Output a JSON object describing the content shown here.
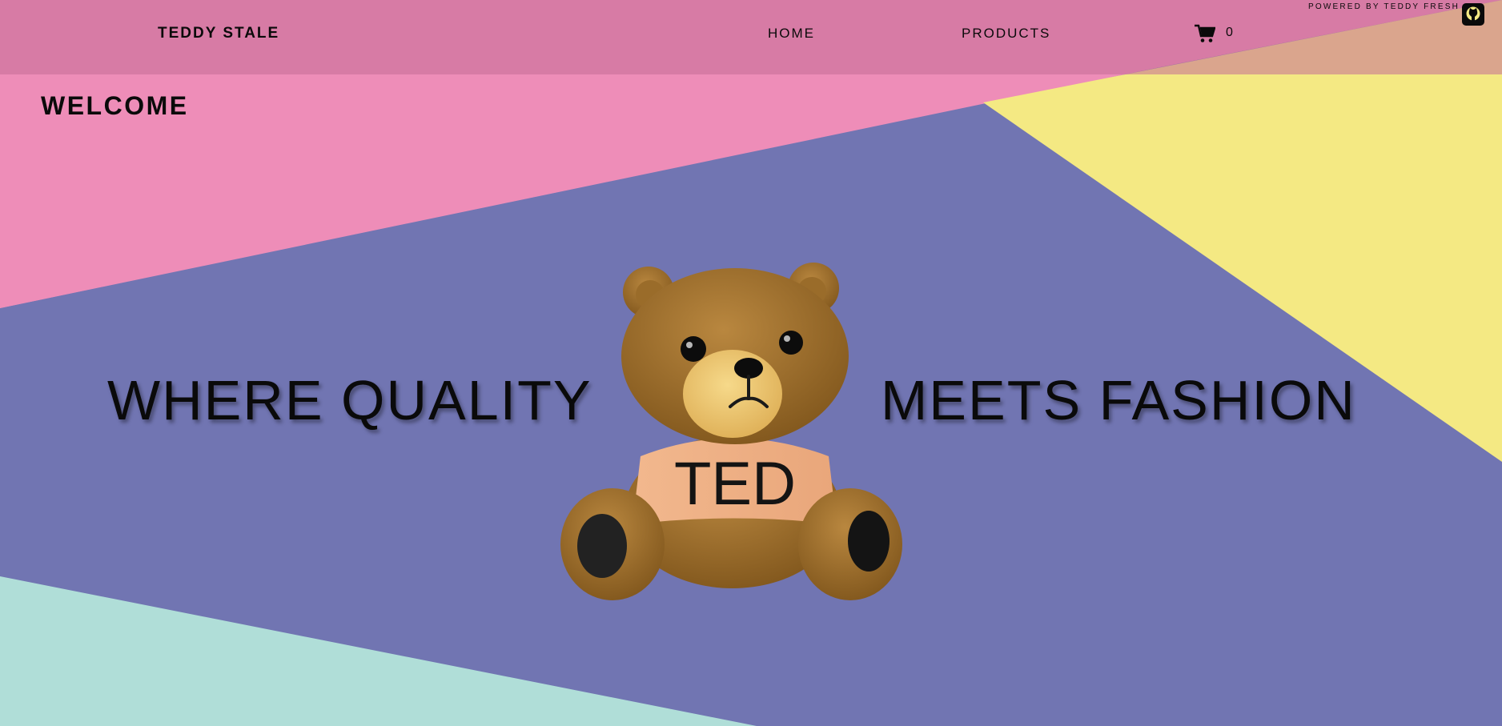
{
  "header": {
    "brand": "TEDDY STALE",
    "nav": [
      {
        "label": "HOME"
      },
      {
        "label": "PRODUCTS"
      }
    ],
    "cart": {
      "icon": "cart-icon",
      "count": "0"
    },
    "powered_by": "POWERED BY TEDDY FRESH",
    "github_icon": "github-icon"
  },
  "hero": {
    "welcome": "WELCOME",
    "tagline_left": "WHERE QUALITY",
    "tagline_right": "MEETS FASHION",
    "mascot_shirt_text": "TED"
  },
  "colors": {
    "pink": "#ee8db8",
    "blue": "#7175b2",
    "yellow": "#f4e983",
    "mint": "#b0ded8",
    "header_overlay": "#c66e96"
  }
}
